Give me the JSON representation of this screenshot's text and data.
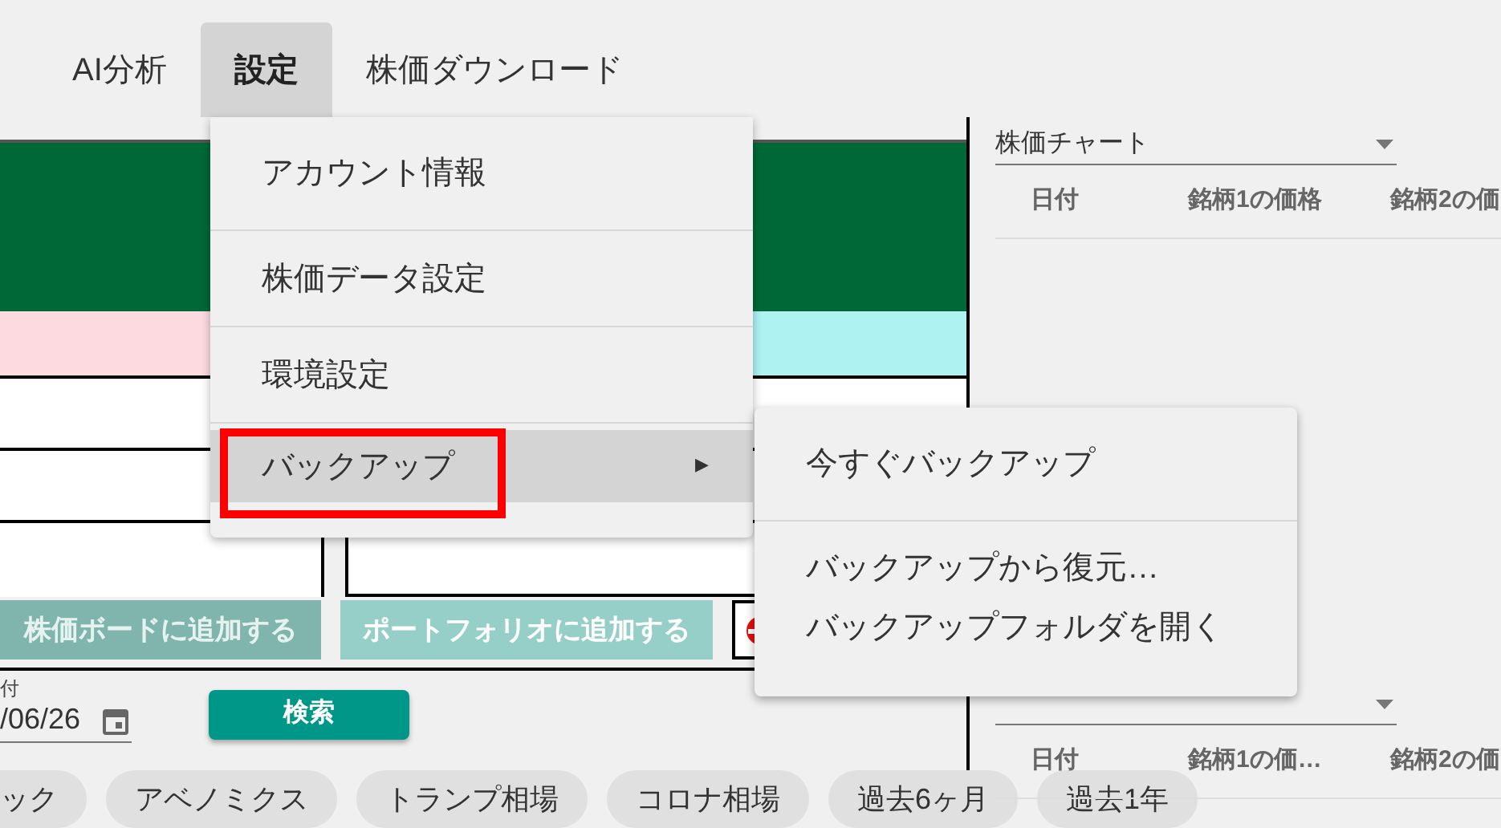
{
  "menu_bar": {
    "items": [
      {
        "label": "AI分析",
        "selected": false
      },
      {
        "label": "設定",
        "selected": true
      },
      {
        "label": "株価ダウンロード",
        "selected": false
      }
    ]
  },
  "dropdown": {
    "items": [
      {
        "label": "アカウント情報",
        "highlighted": false,
        "has_submenu": false,
        "annotated": false
      },
      {
        "label": "株価データ設定",
        "highlighted": false,
        "has_submenu": false,
        "annotated": false
      },
      {
        "label": "環境設定",
        "highlighted": false,
        "has_submenu": false,
        "annotated": false
      },
      {
        "label": "バックアップ",
        "highlighted": true,
        "has_submenu": true,
        "annotated": true
      }
    ],
    "submenu_arrow": "▶"
  },
  "submenu": {
    "groups": [
      {
        "items": [
          "今すぐバックアップ"
        ]
      },
      {
        "items": [
          "バックアップから復元…",
          "バックアップフォルダを開く"
        ]
      }
    ]
  },
  "left_panel": {
    "buttons": [
      {
        "label": "株価ボードに追加する",
        "color": "#7fb5ad"
      },
      {
        "label": "ポートフォリオに追加する",
        "color": "#96cfc8"
      }
    ],
    "date_field": {
      "label": "付",
      "value": "/06/26"
    },
    "search_button": "検索",
    "chips": [
      "ック",
      "アベノミクス",
      "トランプ相場",
      "コロナ相場",
      "過去6ヶ月",
      "過去1年"
    ]
  },
  "right_panel": {
    "tables": [
      {
        "dropdown": "株価チャート",
        "columns": [
          "日付",
          "銘柄1の価格",
          "銘柄2の価"
        ]
      },
      {
        "columns": [
          "日付",
          "銘柄1の価…",
          "銘柄2の価"
        ]
      }
    ]
  }
}
